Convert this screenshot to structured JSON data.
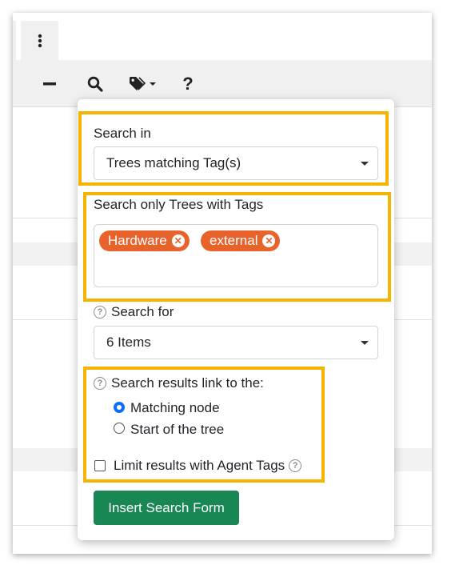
{
  "toolbar": {
    "more_icon": "kebab-vertical-icon",
    "collapse_icon": "minus-icon",
    "search_icon": "search-icon",
    "tag_icon": "tag-dropdown-icon",
    "help_label": "?"
  },
  "popover": {
    "search_in": {
      "label": "Search in",
      "selected": "Trees matching Tag(s)"
    },
    "tags_filter": {
      "label": "Search only Trees with Tags",
      "tags": [
        "Hardware",
        "external"
      ]
    },
    "search_for": {
      "label": "Search for",
      "selected": "6 Items"
    },
    "results_link": {
      "label": "Search results link to the:",
      "options": [
        {
          "label": "Matching node",
          "checked": true
        },
        {
          "label": "Start of the tree",
          "checked": false
        }
      ]
    },
    "limit_agent_tags": {
      "label": "Limit results with Agent Tags",
      "checked": false
    },
    "insert_button": "Insert Search Form"
  },
  "colors": {
    "highlight": "#f5b400",
    "tag_chip": "#e8632b",
    "primary_button": "#198754",
    "radio_checked": "#0d6efd"
  }
}
